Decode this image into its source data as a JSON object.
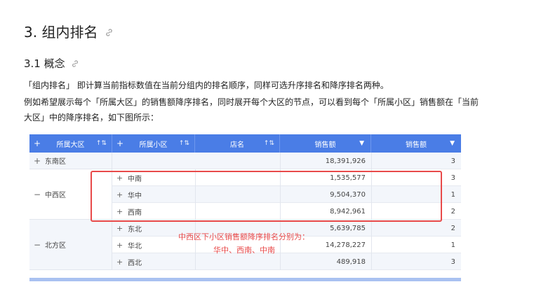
{
  "heading1": "3. 组内排名",
  "heading2": "3.1 概念",
  "para1": "「组内排名」 即计算当前指标数值在当前分组内的排名顺序，同样可选升序排名和降序排名两种。",
  "para2": "例如希望展示每个「所属大区」的销售额降序排名，同时展开每个大区的节点，可以看到每个「所属小区」销售额在「当前",
  "para3": "大区」中的降序排名，如下图所示：",
  "table": {
    "headers": [
      "所属大区",
      "所属小区",
      "店名",
      "销售额",
      "销售额"
    ],
    "regions": [
      {
        "name": "东南区",
        "expanded": false,
        "total": "18,391,926",
        "rank": "3"
      },
      {
        "name": "中西区",
        "expanded": true,
        "rows": [
          {
            "sub": "中南",
            "value": "1,535,577",
            "rank": "3"
          },
          {
            "sub": "华中",
            "value": "9,504,370",
            "rank": "1"
          },
          {
            "sub": "西南",
            "value": "8,942,961",
            "rank": "2"
          }
        ]
      },
      {
        "name": "北方区",
        "expanded": true,
        "rows": [
          {
            "sub": "东北",
            "value": "5,639,785",
            "rank": "2"
          },
          {
            "sub": "华北",
            "value": "14,278,227",
            "rank": "1"
          },
          {
            "sub": "西北",
            "value": "489,918",
            "rank": "3"
          }
        ]
      }
    ]
  },
  "annotation": {
    "line1": "中西区下小区销售额降序排名分别为：",
    "line2": "华中、西南、中南"
  },
  "colors": {
    "header_bg": "#4a7de6",
    "highlight": "#e84a4a",
    "row_alt": "#f3f6fb"
  }
}
